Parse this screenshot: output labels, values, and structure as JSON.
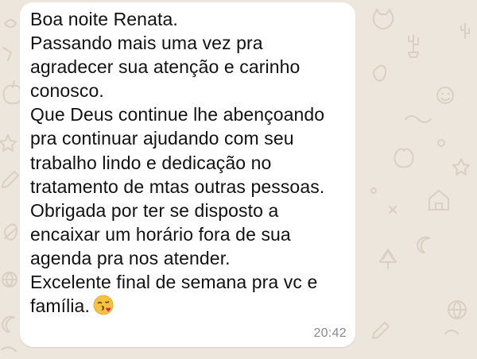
{
  "chat": {
    "background_color": "#ede6dc",
    "pattern_color": "#d9d0c3",
    "pattern_icons": [
      "doodle-icon",
      "cactus-icon",
      "apple-icon",
      "moon-icon",
      "pencil-icon",
      "house-icon",
      "leaf-icon",
      "cat-icon",
      "globe-icon",
      "tree-icon",
      "star-icon"
    ]
  },
  "message": {
    "bubble_color": "#ffffff",
    "text_color": "#111111",
    "lines": [
      "Boa noite Renata.",
      "Passando mais uma vez pra",
      "agradecer sua atenção e carinho",
      "conosco.",
      "Que Deus continue lhe abençoando",
      "pra continuar ajudando com seu",
      "trabalho lindo e dedicação no",
      "tratamento de mtas outras pessoas.",
      "Obrigada por ter se disposto a",
      "encaixar um horário fora de sua",
      "agenda pra nos atender.",
      "Excelente final de semana pra vc e",
      "família."
    ],
    "emoji": "kissing-face-with-heart-icon",
    "time": "20:42",
    "time_color": "#8a8a8a"
  }
}
